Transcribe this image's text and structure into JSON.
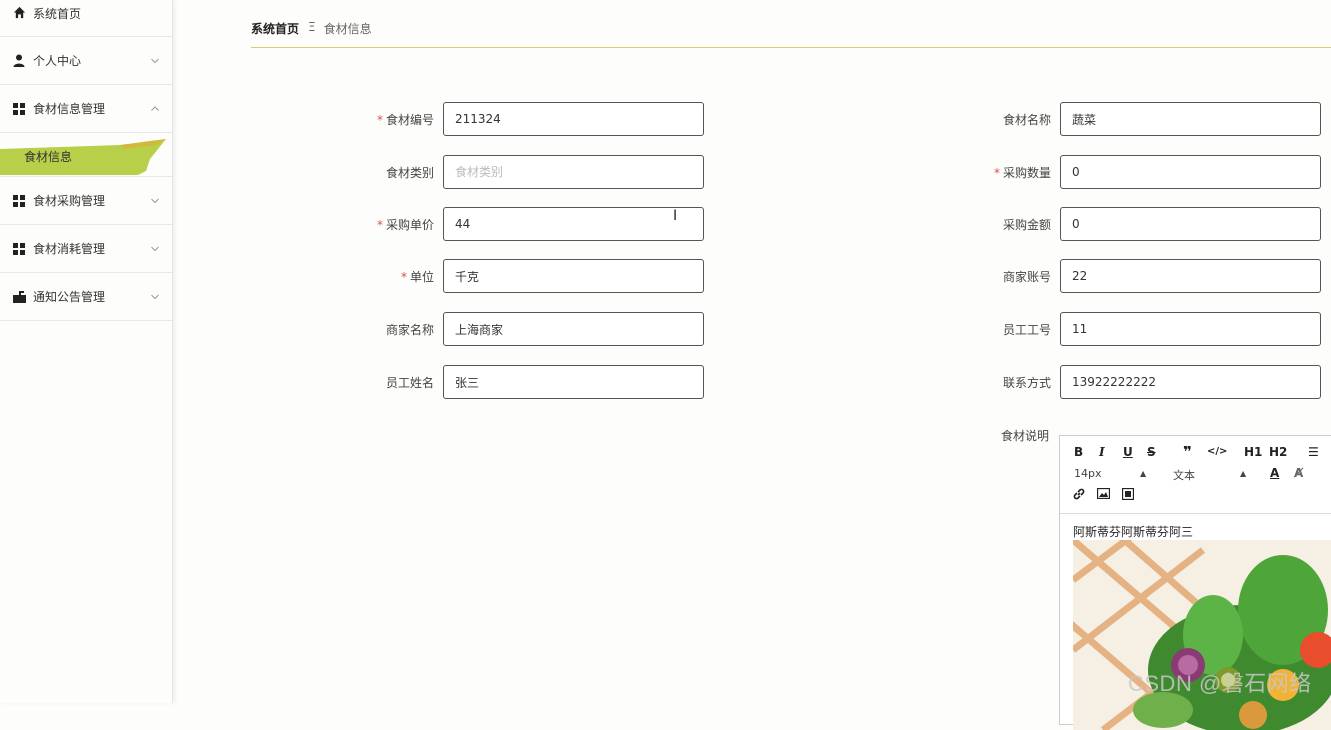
{
  "sidebar": {
    "home": "系统首页",
    "personal": "个人中心",
    "food_info_mgmt": "食材信息管理",
    "food_info": "食材信息",
    "purchase_mgmt": "食材采购管理",
    "consume_mgmt": "食材消耗管理",
    "notice_mgmt": "通知公告管理",
    "active_color": "#b8cf4a"
  },
  "breadcrumb": {
    "home": "系统首页",
    "separator": "Ξ",
    "current": "食材信息"
  },
  "form": {
    "left": [
      {
        "label": "食材编号",
        "required": true,
        "value": "211324",
        "placeholder": ""
      },
      {
        "label": "食材类别",
        "required": false,
        "value": "",
        "placeholder": "食材类别"
      },
      {
        "label": "采购单价",
        "required": true,
        "value": "44",
        "placeholder": ""
      },
      {
        "label": "单位",
        "required": true,
        "value": "千克",
        "placeholder": ""
      },
      {
        "label": "商家名称",
        "required": false,
        "value": "上海商家",
        "placeholder": ""
      },
      {
        "label": "员工姓名",
        "required": false,
        "value": "张三",
        "placeholder": ""
      }
    ],
    "right": [
      {
        "label": "食材名称",
        "required": false,
        "value": "蔬菜",
        "placeholder": ""
      },
      {
        "label": "采购数量",
        "required": true,
        "value": "0",
        "placeholder": ""
      },
      {
        "label": "采购金额",
        "required": false,
        "value": "0",
        "placeholder": ""
      },
      {
        "label": "商家账号",
        "required": false,
        "value": "22",
        "placeholder": ""
      },
      {
        "label": "员工工号",
        "required": false,
        "value": "11",
        "placeholder": ""
      },
      {
        "label": "联系方式",
        "required": false,
        "value": "13922222222",
        "placeholder": ""
      }
    ]
  },
  "editor": {
    "label": "食材说明",
    "font_size": "14px",
    "text_type": "文本",
    "h1": "H1",
    "h2": "H2",
    "content_text": "阿斯蒂芬阿斯蒂芬阿三"
  },
  "watermark": "CSDN @磐石网络"
}
